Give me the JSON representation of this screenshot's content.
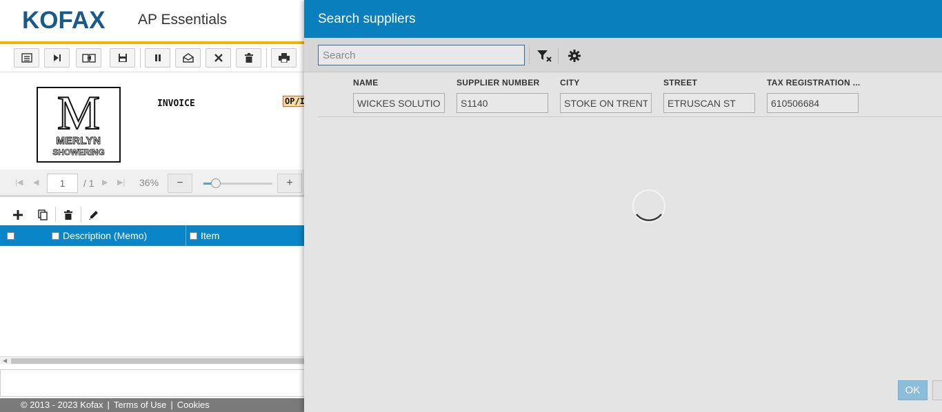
{
  "app": {
    "logo": "KOFAX",
    "title": "AP Essentials"
  },
  "document": {
    "logo_letter": "M",
    "logo_line1": "MERLYN",
    "logo_line2": "SHOWERING",
    "invoice_label": "INVOICE",
    "tag_text": "OP/I"
  },
  "viewer": {
    "page_number": "1",
    "page_total": "/ 1",
    "zoom": "36%",
    "zoom_out": "−",
    "zoom_in": "+",
    "zoom_slider_fraction": 0.18
  },
  "grid": {
    "columns": [
      "Description (Memo)",
      "Item"
    ]
  },
  "footer": {
    "copyright": "© 2013 - 2023 Kofax",
    "terms": "Terms of Use",
    "cookies": "Cookies"
  },
  "dialog": {
    "title": "Search suppliers",
    "search_placeholder": "Search",
    "columns": [
      "NAME",
      "SUPPLIER NUMBER",
      "CITY",
      "STREET",
      "TAX REGISTRATION ..."
    ],
    "filters": [
      "WICKES SOLUTIONS",
      "S1140",
      "STOKE ON TRENT",
      "ETRUSCAN ST",
      "610506684"
    ],
    "ok_label": "OK"
  },
  "colors": {
    "brand_blue": "#0a7fbe",
    "accent_yellow": "#f5b400",
    "grid_header": "#0a85c8"
  }
}
